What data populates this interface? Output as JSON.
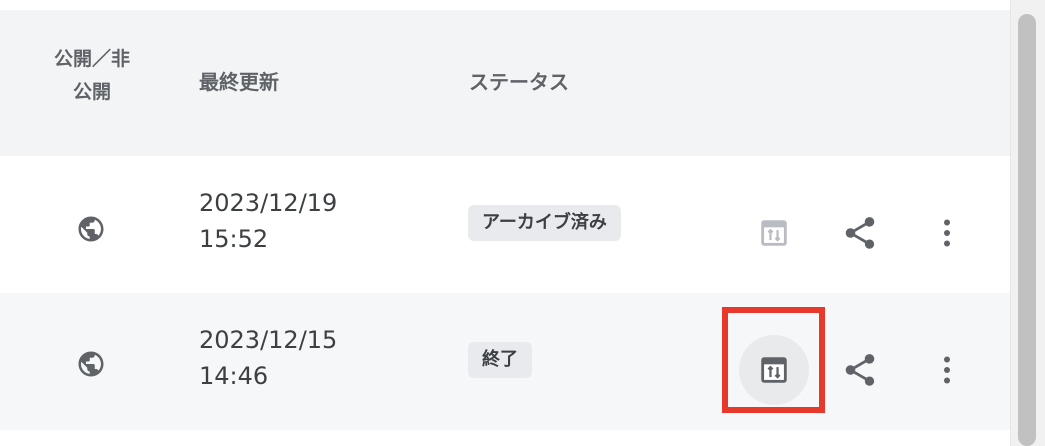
{
  "header": {
    "public_line1": "公開／非",
    "public_line2": "公開",
    "updated": "最終更新",
    "status": "ステータス"
  },
  "rows": [
    {
      "visibility_icon": "globe-icon",
      "date": "2023/12/19",
      "time": "15:52",
      "status": "アーカイブ済み",
      "actions": [
        "panel-icon",
        "share-icon",
        "more-vert-icon"
      ]
    },
    {
      "visibility_icon": "globe-icon",
      "date": "2023/12/15",
      "time": "14:46",
      "status": "終了",
      "actions": [
        "panel-icon",
        "share-icon",
        "more-vert-icon"
      ]
    }
  ],
  "colors": {
    "header_bg": "#f3f4f5",
    "icon": "#5f6368",
    "badge_bg": "#e8eaed",
    "highlight": "#e6392b"
  }
}
